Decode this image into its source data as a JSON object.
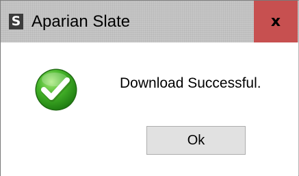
{
  "window": {
    "app_icon_letter": "S",
    "title": "Aparian Slate",
    "close_label": "x"
  },
  "dialog": {
    "icon": "success-check-icon",
    "message": "Download Successful.",
    "ok_label": "Ok"
  },
  "colors": {
    "titlebar": "#c6c6c6",
    "close_button": "#c75050",
    "success_green": "#3fae25",
    "button_face": "#e1e1e1"
  }
}
